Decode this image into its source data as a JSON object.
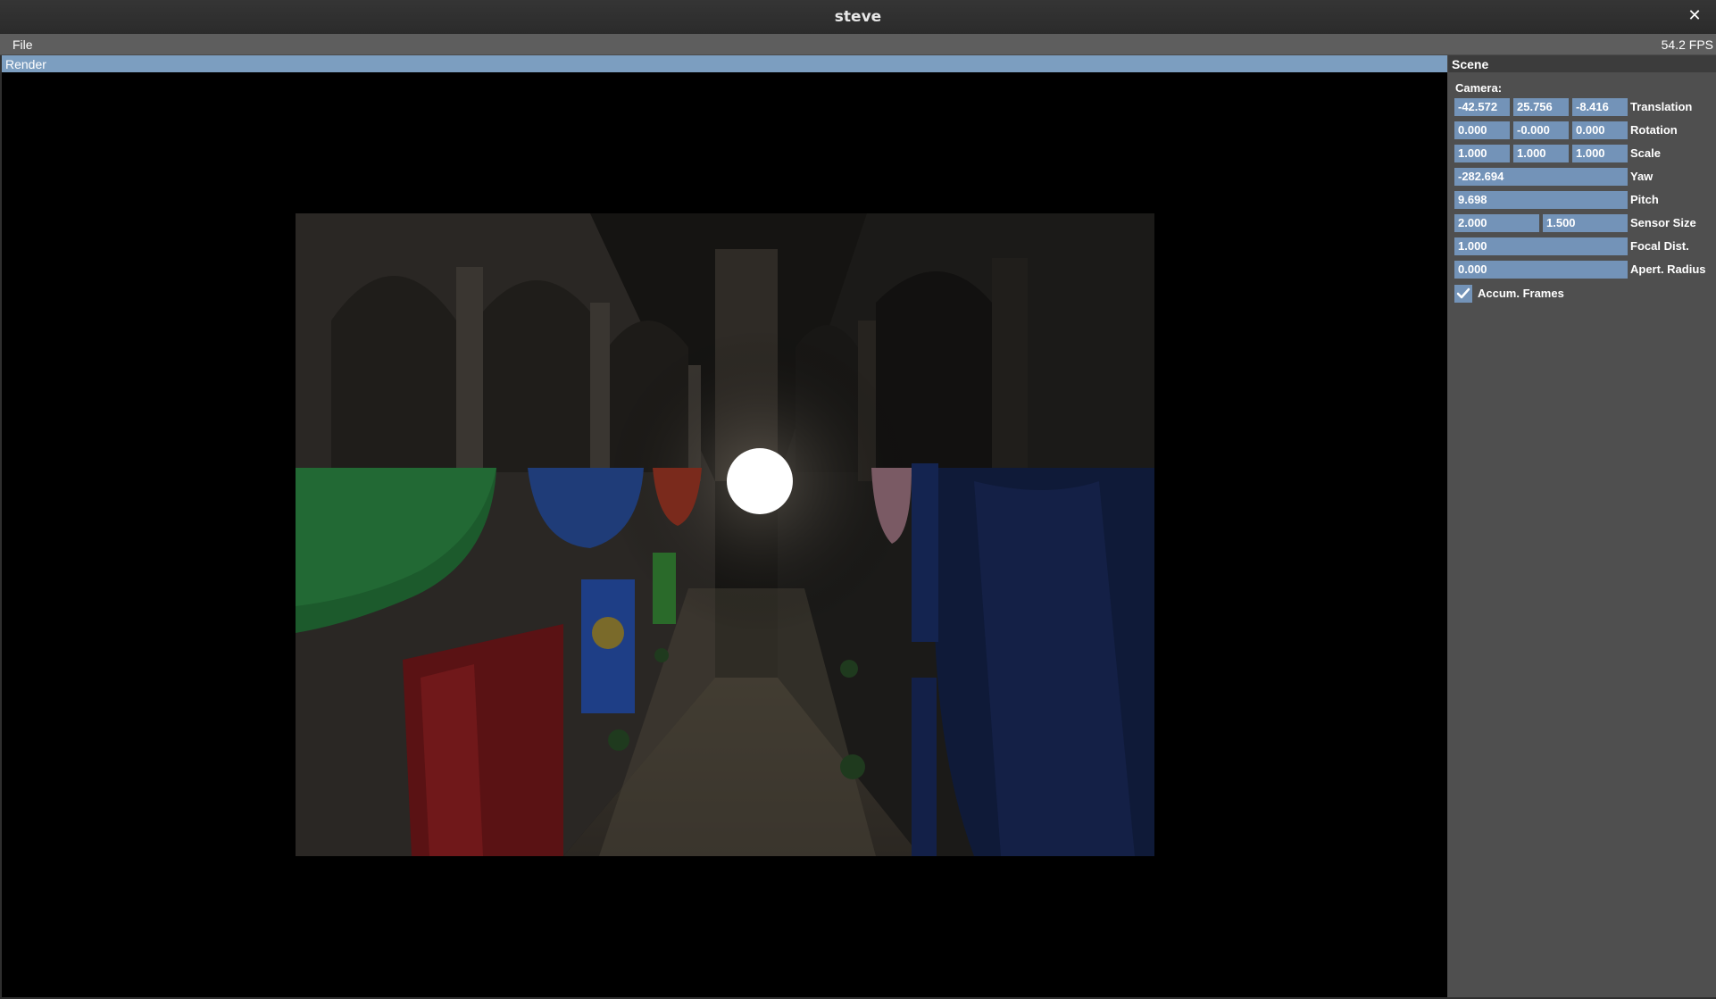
{
  "window": {
    "title": "steve",
    "close_glyph": "✕"
  },
  "menubar": {
    "file_label": "File",
    "fps": "54.2 FPS"
  },
  "render": {
    "title": "Render"
  },
  "scene": {
    "title": "Scene",
    "camera_label": "Camera:",
    "translation": {
      "x": "-42.572",
      "y": "25.756",
      "z": "-8.416",
      "label": "Translation"
    },
    "rotation": {
      "x": "0.000",
      "y": "-0.000",
      "z": "0.000",
      "label": "Rotation"
    },
    "scale": {
      "x": "1.000",
      "y": "1.000",
      "z": "1.000",
      "label": "Scale"
    },
    "yaw": {
      "value": "-282.694",
      "label": "Yaw"
    },
    "pitch": {
      "value": "9.698",
      "label": "Pitch"
    },
    "sensor_size": {
      "w": "2.000",
      "h": "1.500",
      "label": "Sensor Size"
    },
    "focal_dist": {
      "value": "1.000",
      "label": "Focal Dist."
    },
    "apert_radius": {
      "value": "0.000",
      "label": "Apert. Radius"
    },
    "accum_frames": {
      "checked": true,
      "label": "Accum. Frames"
    }
  },
  "colors": {
    "accent": "#7393b8",
    "render_header": "#7c9ec0",
    "panel_bg": "#4f4f4f"
  }
}
